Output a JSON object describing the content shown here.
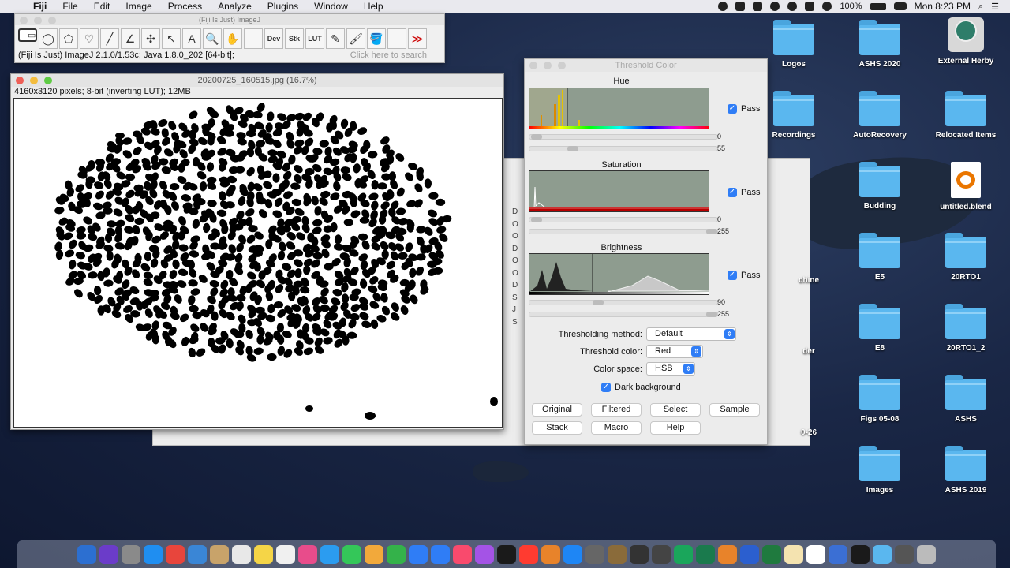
{
  "menubar": {
    "app": "Fiji",
    "items": [
      "File",
      "Edit",
      "Image",
      "Process",
      "Analyze",
      "Plugins",
      "Window",
      "Help"
    ],
    "battery": "100%",
    "clock": "Mon 8:23 PM"
  },
  "fiji_toolbar": {
    "title": "(Fiji Is Just) ImageJ",
    "tools": [
      {
        "name": "rectangle-tool",
        "glyph": "▭"
      },
      {
        "name": "oval-tool",
        "glyph": "◯"
      },
      {
        "name": "polygon-tool",
        "glyph": "⬠"
      },
      {
        "name": "freehand-tool",
        "glyph": "♡"
      },
      {
        "name": "line-tool",
        "glyph": "╱"
      },
      {
        "name": "angle-tool",
        "glyph": "∠"
      },
      {
        "name": "point-tool",
        "glyph": "✣"
      },
      {
        "name": "wand-tool",
        "glyph": "↖"
      },
      {
        "name": "text-tool",
        "glyph": "A"
      },
      {
        "name": "zoom-tool",
        "glyph": "🔍"
      },
      {
        "name": "hand-tool",
        "glyph": "✋"
      },
      {
        "name": "blank-tool",
        "glyph": ""
      },
      {
        "name": "dev-tool",
        "glyph": "Dev"
      },
      {
        "name": "stk-tool",
        "glyph": "Stk"
      },
      {
        "name": "lut-tool",
        "glyph": "LUT"
      },
      {
        "name": "pencil-tool",
        "glyph": "✎"
      },
      {
        "name": "brush-tool",
        "glyph": "🖌"
      },
      {
        "name": "flood-tool",
        "glyph": "🪣"
      },
      {
        "name": "blank-tool-2",
        "glyph": ""
      },
      {
        "name": "more-tools",
        "glyph": "≫"
      }
    ],
    "status": "(Fiji Is Just) ImageJ 2.1.0/1.53c; Java 1.8.0_202 [64-bit];",
    "search_placeholder": "Click here to search"
  },
  "image_window": {
    "title": "20200725_160515.jpg (16.7%)",
    "info": "4160x3120 pixels; 8-bit (inverting LUT); 12MB"
  },
  "back_window": {
    "rows": [
      "D",
      "O",
      "O",
      "D",
      "O",
      "O",
      "D",
      "S",
      "J",
      "S"
    ]
  },
  "threshold": {
    "title": "Threshold Color",
    "hue": {
      "label": "Hue",
      "pass": "Pass",
      "min": "0",
      "max": "55"
    },
    "saturation": {
      "label": "Saturation",
      "pass": "Pass",
      "min": "0",
      "max": "255"
    },
    "brightness": {
      "label": "Brightness",
      "pass": "Pass",
      "min": "90",
      "max": "255"
    },
    "method_label": "Thresholding method:",
    "method_value": "Default",
    "color_label": "Threshold color:",
    "color_value": "Red",
    "space_label": "Color space:",
    "space_value": "HSB",
    "dark_bg": "Dark background",
    "buttons": [
      "Original",
      "Filtered",
      "Select",
      "Sample",
      "Stack",
      "Macro",
      "Help"
    ]
  },
  "desktop_icons": [
    {
      "label": "Logos",
      "kind": "folder"
    },
    {
      "label": "ASHS 2020",
      "kind": "folder"
    },
    {
      "label": "External Herby",
      "kind": "drive"
    },
    {
      "label": "Recordings",
      "kind": "folder"
    },
    {
      "label": "AutoRecovery",
      "kind": "folder"
    },
    {
      "label": "Relocated Items",
      "kind": "folder"
    },
    {
      "label": "Budding",
      "kind": "folder"
    },
    {
      "label": "untitled.blend",
      "kind": "blend"
    },
    {
      "label": "E5",
      "kind": "folder"
    },
    {
      "label": "20RTO1",
      "kind": "folder"
    },
    {
      "label": "E8",
      "kind": "folder"
    },
    {
      "label": "20RTO1_2",
      "kind": "folder"
    },
    {
      "label": "Figs 05-08",
      "kind": "folder"
    },
    {
      "label": "ASHS",
      "kind": "folder"
    },
    {
      "label": "Images",
      "kind": "folder"
    },
    {
      "label": "ASHS 2019",
      "kind": "folder"
    }
  ],
  "partial_labels": [
    "chine",
    "der",
    "0-26"
  ],
  "dock": {
    "colors": [
      "#2c6fd1",
      "#6b3cc9",
      "#8a8a8a",
      "#1f8ef1",
      "#e8453c",
      "#3a86d6",
      "#c8a36a",
      "#e8e8e8",
      "#f5d547",
      "#f0f0f0",
      "#e84c8b",
      "#2b9cf0",
      "#34c759",
      "#f2a93b",
      "#34b24a",
      "#2f7df6",
      "#2f7df6",
      "#f94a6d",
      "#a453e6",
      "#1a1a1a",
      "#ff3b30",
      "#e8832a",
      "#1e86f5",
      "#666666",
      "#8a6b3a",
      "#333333",
      "#444444",
      "#1aa65b",
      "#1a7a4d",
      "#e8832a",
      "#2b5fcf",
      "#1f7a3e",
      "#f4e3b0",
      "#ffffff",
      "#3b6fd4",
      "#1a1a1a",
      "#5ab7ef",
      "#555555",
      "#bbbbbb"
    ]
  }
}
